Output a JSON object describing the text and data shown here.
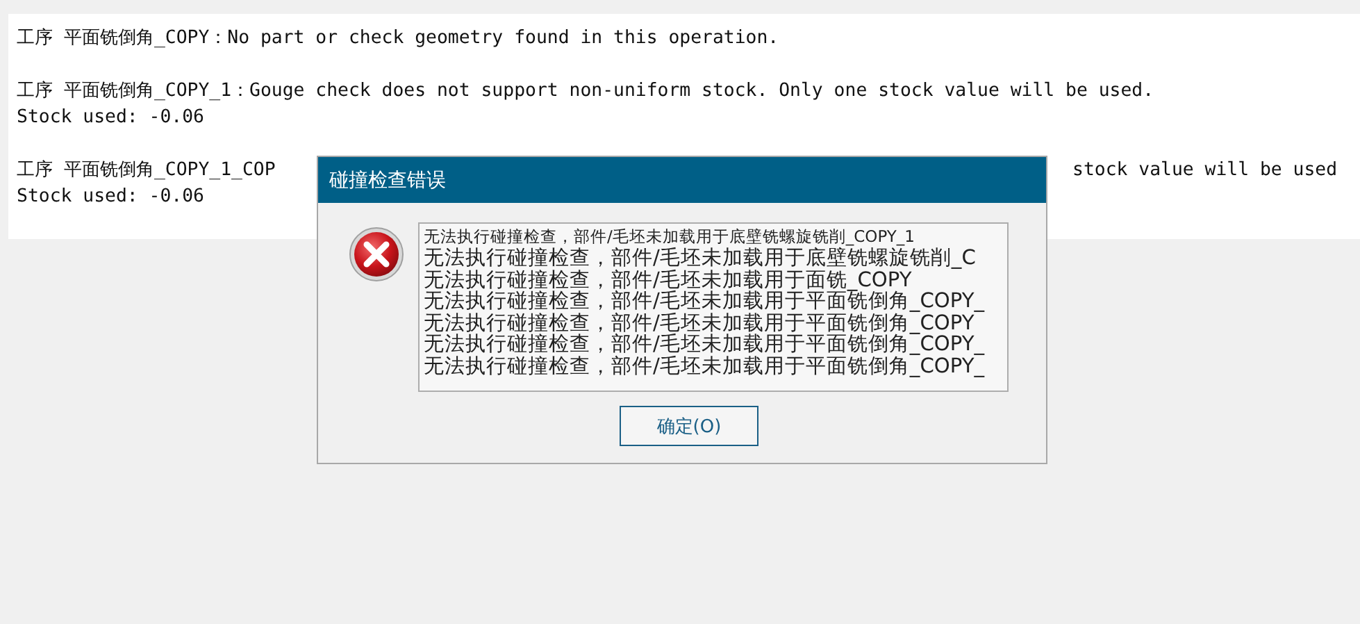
{
  "log": {
    "entries": [
      {
        "lines": [
          {
            "parts": [
              "工序 平面铣倒角_COPY：No part or check geometry found in this operation."
            ]
          }
        ]
      },
      {
        "lines": [
          {
            "parts": [
              "工序 平面铣倒角_COPY_1：Gouge check does not support non-uniform stock. Only one stock value will be used."
            ]
          },
          {
            "parts": [
              "Stock used: -0.06"
            ]
          }
        ]
      },
      {
        "lines": [
          {
            "parts": [
              "工序 平面铣倒角_COPY_1_COP",
              "stock value will be used"
            ]
          },
          {
            "parts": [
              "Stock used: -0.06"
            ]
          }
        ]
      }
    ]
  },
  "dialog": {
    "title": "碰撞检查错误",
    "kind": "error",
    "messages": [
      {
        "text": "无法执行碰撞检查，部件/毛坯未加载用于底壁铣螺旋铣削_COPY_1",
        "kind": "small"
      },
      {
        "text": "无法执行碰撞检查，部件/毛坯未加载用于底壁铣螺旋铣削_C",
        "kind": "large"
      },
      {
        "text": "无法执行碰撞检查，部件/毛坯未加载用于面铣_COPY",
        "kind": "large"
      },
      {
        "text": "无法执行碰撞检查，部件/毛坯未加载用于平面铣倒角_COPY_",
        "kind": "large"
      },
      {
        "text": "无法执行碰撞检查，部件/毛坯未加载用于平面铣倒角_COPY",
        "kind": "large"
      },
      {
        "text": "无法执行碰撞检查，部件/毛坯未加载用于平面铣倒角_COPY_",
        "kind": "large"
      },
      {
        "text": "无法执行碰撞检查，部件/毛坯未加载用于平面铣倒角_COPY_",
        "kind": "large"
      }
    ],
    "buttons": [
      {
        "label": "确定(O)"
      }
    ]
  }
}
